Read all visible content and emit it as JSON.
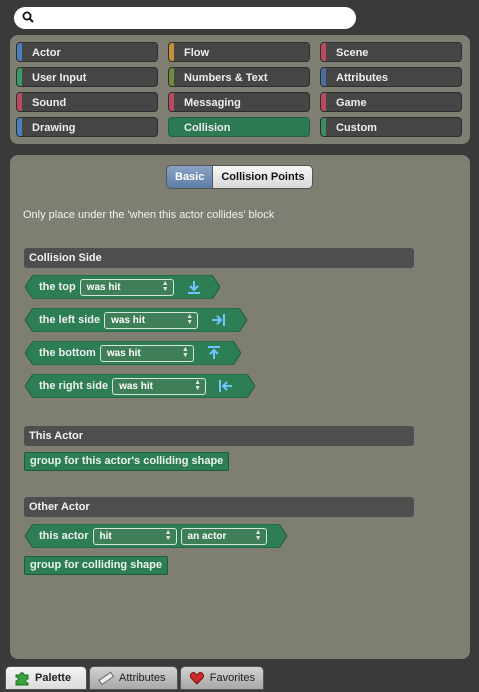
{
  "search": {
    "placeholder": "",
    "value": ""
  },
  "categories": [
    {
      "label": "Actor",
      "color": "#4a7fbf"
    },
    {
      "label": "Flow",
      "color": "#c9903a"
    },
    {
      "label": "Scene",
      "color": "#b84a63"
    },
    {
      "label": "User Input",
      "color": "#3d9a66"
    },
    {
      "label": "Numbers & Text",
      "color": "#6e8b3d"
    },
    {
      "label": "Attributes",
      "color": "#4a6e9e"
    },
    {
      "label": "Sound",
      "color": "#b84a63"
    },
    {
      "label": "Messaging",
      "color": "#b84a63"
    },
    {
      "label": "Game",
      "color": "#b84a63"
    },
    {
      "label": "Drawing",
      "color": "#4a7fbf"
    },
    {
      "label": "Collision",
      "color": "#2b7a54",
      "active": true
    },
    {
      "label": "Custom",
      "color": "#3d8a66"
    }
  ],
  "mode_tabs": {
    "basic": "Basic",
    "points": "Collision Points"
  },
  "hint": "Only place under the 'when this actor collides' block",
  "sections": {
    "collision_side": "Collision Side",
    "this_actor": "This Actor",
    "other_actor": "Other Actor"
  },
  "side_blocks": [
    {
      "label": "the top",
      "select": "was hit",
      "icon": "arrow-down-to-bar-icon"
    },
    {
      "label": "the left side",
      "select": "was hit",
      "icon": "arrow-right-to-bar-icon"
    },
    {
      "label": "the bottom",
      "select": "was hit",
      "icon": "arrow-up-to-bar-icon"
    },
    {
      "label": "the right side",
      "select": "was hit",
      "icon": "arrow-left-to-bar-icon"
    }
  ],
  "this_actor_block": "group for this actor's colliding shape",
  "other_actor_block": {
    "label": "this actor",
    "select1": "hit",
    "select2": "an actor"
  },
  "colliding_shape_block": "group for colliding shape",
  "bottom_tabs": {
    "palette": "Palette",
    "attributes": "Attributes",
    "favorites": "Favorites"
  },
  "colors": {
    "block_green": "#2d7d55",
    "panel": "#7e7e72",
    "accent_blue": "#5e7ea7"
  }
}
